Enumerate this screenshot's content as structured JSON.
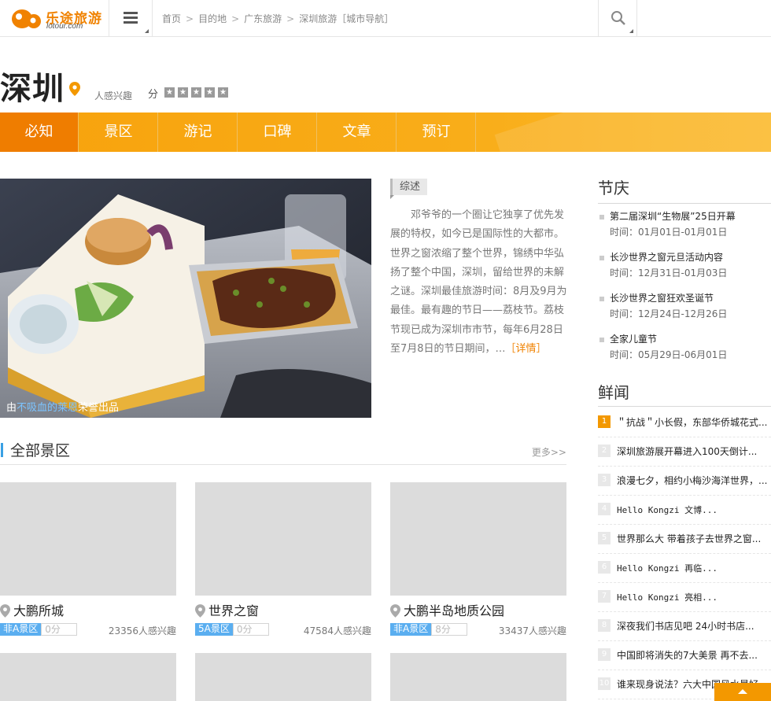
{
  "header": {
    "logo_name": "乐途旅游",
    "logo_domain": "lotour.com",
    "breadcrumb": [
      "首页",
      "目的地",
      "广东旅游",
      "深圳旅游［城市导航］"
    ]
  },
  "city": {
    "name": "深圳",
    "interest_label": "人感兴趣",
    "score_label": "分",
    "stars": 5
  },
  "nav": [
    "必知",
    "景区",
    "游记",
    "口碑",
    "文章",
    "预订"
  ],
  "hero": {
    "caption_prefix": "由",
    "caption_user": "不吸血的莱恩",
    "caption_suffix": "荣誉出品"
  },
  "summary": {
    "tag": "综述",
    "text": "邓爷爷的一个圈让它独享了优先发展的特权，如今已是国际性的大都市。世界之窗浓缩了整个世界，锦绣中华弘扬了整个中国，深圳，留给世界的未解之谜。深圳最佳旅游时间：8月及9月为最佳。最有趣的节日——荔枝节。荔枝节现已成为深圳市市节，每年6月28日至7月8日的节日期间，…",
    "more": "［详情］"
  },
  "scenic": {
    "title": "全部景区",
    "more": "更多>>",
    "cards": [
      {
        "name": "大鹏所城",
        "level": "非A景区",
        "score": "0分",
        "count": "23356人感兴趣"
      },
      {
        "name": "世界之窗",
        "level": "5A景区",
        "score": "0分",
        "count": "47584人感兴趣"
      },
      {
        "name": "大鹏半岛地质公园",
        "level": "非A景区",
        "score": "8分",
        "count": "33437人感兴趣"
      }
    ]
  },
  "festivals": {
    "title": "节庆",
    "items": [
      {
        "title": "第二届深圳“生物展”25日开幕",
        "date": "时间：01月01日-01月01日"
      },
      {
        "title": "长沙世界之窗元旦活动内容",
        "date": "时间：12月31日-01月03日"
      },
      {
        "title": "长沙世界之窗狂欢圣诞节",
        "date": "时间：12月24日-12月26日"
      },
      {
        "title": "全家儿童节",
        "date": "时间：05月29日-06月01日"
      }
    ]
  },
  "news": {
    "title": "鲜闻",
    "items": [
      "＂抗战＂小长假，东部华侨城花式...",
      "深圳旅游展开幕进入100天倒计...",
      "浪漫七夕，相约小梅沙海洋世界，...",
      "Hello Kongzi 文博...",
      "世界那么大 带着孩子去世界之窗...",
      "Hello Kongzi 再临...",
      "Hello Kongzi 亮相...",
      "深夜我们书店见吧 24小时书店...",
      "中国即将消失的7大美景 再不去...",
      "谁来现身说法？六大中国风水最好"
    ]
  }
}
